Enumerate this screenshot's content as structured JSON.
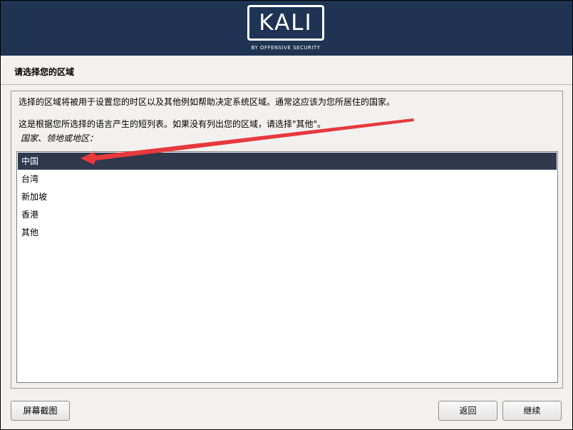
{
  "banner": {
    "logo_text": "KALI",
    "logo_subtitle": "BY OFFENSIVE SECURITY",
    "background": "#1f3454"
  },
  "page": {
    "heading": "请选择您的区域",
    "description": "选择的区域将被用于设置您的时区以及其他例如帮助决定系统区域。通常这应该为您所居住的国家。",
    "note": "这是根据您所选择的语言产生的短列表。如果没有列出您的区域，请选择\"其他\"。",
    "list_label": "国家、领地或地区："
  },
  "regions": {
    "items": [
      "中国",
      "台湾",
      "新加坡",
      "香港",
      "其他"
    ],
    "selected": "中国",
    "selected_color": "#31394d"
  },
  "buttons": {
    "screenshot": "屏幕截图",
    "back": "返回",
    "continue": "继续"
  },
  "annotation": {
    "arrow_color": "#e8393c"
  }
}
